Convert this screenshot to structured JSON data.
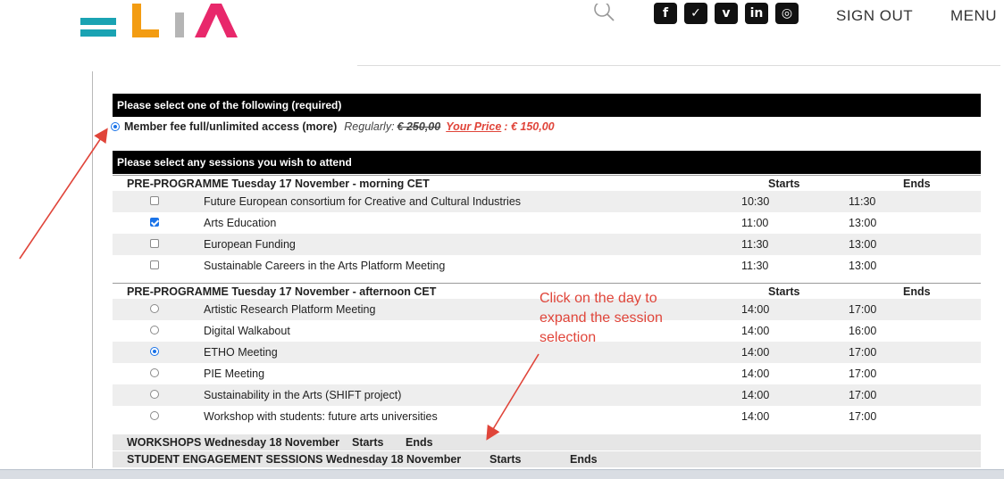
{
  "colors": {
    "accent_red": "#e0453a",
    "brand_teal": "#1aa3b3",
    "brand_orange": "#f39c12",
    "brand_pink": "#e8286b",
    "check_blue": "#1a73e8"
  },
  "header": {
    "search_icon": "search-icon",
    "social_icons": [
      {
        "name": "facebook-icon",
        "glyph": "f"
      },
      {
        "name": "twitter-icon",
        "glyph": "✓"
      },
      {
        "name": "vimeo-icon",
        "glyph": "v"
      },
      {
        "name": "linkedin-icon",
        "glyph": "in"
      },
      {
        "name": "instagram-icon",
        "glyph": "◎"
      }
    ],
    "signout_label": "SIGN OUT",
    "menu_label": "MENU"
  },
  "fee": {
    "heading": "Please select one of the following (required)",
    "option_label": "Member fee full/unlimited access (more)",
    "regularly_label": "Regularly:",
    "old_price": "€ 250,00",
    "your_price_label": "Your Price",
    "your_price_sep": ":",
    "price": "€ 150,00"
  },
  "sessions": {
    "heading": "Please select any sessions you wish to attend",
    "groups": [
      {
        "title": "PRE-PROGRAMME Tuesday 17 November - morning CET",
        "starts": "Starts",
        "ends": "Ends",
        "rows": [
          {
            "name": "Future European consortium for Creative and Cultural Industries",
            "start": "10:30",
            "end": "11:30",
            "checked": false
          },
          {
            "name": "Arts Education",
            "start": "11:00",
            "end": "13:00",
            "checked": true
          },
          {
            "name": "European Funding",
            "start": "11:30",
            "end": "13:00",
            "checked": false
          },
          {
            "name": "Sustainable Careers in the Arts Platform Meeting",
            "start": "11:30",
            "end": "13:00",
            "checked": false
          }
        ]
      },
      {
        "title": "PRE-PROGRAMME Tuesday 17 November - afternoon CET",
        "starts": "Starts",
        "ends": "Ends",
        "rows": [
          {
            "name": "Artistic Research Platform Meeting",
            "start": "14:00",
            "end": "17:00",
            "checked": false
          },
          {
            "name": "Digital Walkabout",
            "start": "14:00",
            "end": "16:00",
            "checked": false
          },
          {
            "name": "ETHO Meeting",
            "start": "14:00",
            "end": "17:00",
            "checked": true
          },
          {
            "name": "PIE Meeting",
            "start": "14:00",
            "end": "17:00",
            "checked": false
          },
          {
            "name": "Sustainability in the Arts (SHIFT project)",
            "start": "14:00",
            "end": "17:00",
            "checked": false
          },
          {
            "name": "Workshop with students: future arts universities",
            "start": "14:00",
            "end": "17:00",
            "checked": false
          }
        ]
      }
    ],
    "collapsed": [
      {
        "title": "WORKSHOPS Wednesday 18 November",
        "starts": "Starts",
        "ends": "Ends"
      },
      {
        "title": "STUDENT ENGAGEMENT SESSIONS Wednesday 18 November",
        "starts": "Starts",
        "ends": "Ends"
      }
    ]
  },
  "annotation": {
    "lines": [
      "Click on the day to",
      "expand the session",
      "selection"
    ]
  }
}
